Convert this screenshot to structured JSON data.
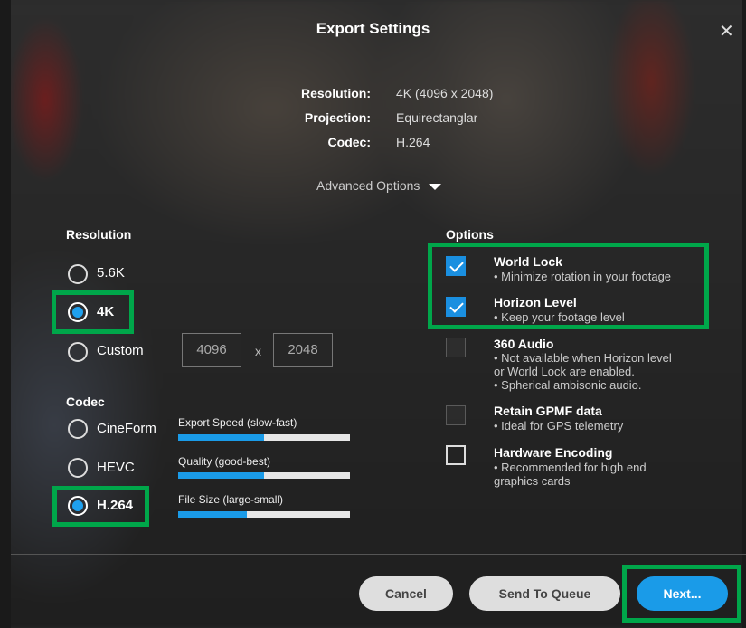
{
  "dialog": {
    "title": "Export Settings",
    "close_icon": "close-icon"
  },
  "summary": [
    {
      "label": "Resolution:",
      "value": "4K (4096 x 2048)"
    },
    {
      "label": "Projection:",
      "value": "Equirectanglar"
    },
    {
      "label": "Codec:",
      "value": "H.264"
    }
  ],
  "advanced_options": {
    "label": "Advanced Options",
    "icon": "caret-down-icon"
  },
  "resolution": {
    "heading": "Resolution",
    "options": [
      {
        "label": "5.6K",
        "checked": false
      },
      {
        "label": "4K",
        "checked": true
      },
      {
        "label": "Custom",
        "checked": false
      }
    ],
    "custom_width": "4096",
    "custom_height": "2048",
    "x_label": "x"
  },
  "codec": {
    "heading": "Codec",
    "options": [
      {
        "label": "CineForm",
        "checked": false
      },
      {
        "label": "HEVC",
        "checked": false
      },
      {
        "label": "H.264",
        "checked": true
      }
    ],
    "meters": [
      {
        "label": "Export Speed (slow-fast)",
        "value": 0.5
      },
      {
        "label": "Quality (good-best)",
        "value": 0.5
      },
      {
        "label": "File Size (large-small)",
        "value": 0.4
      }
    ]
  },
  "options": {
    "heading": "Options",
    "items": [
      {
        "title": "World Lock",
        "desc": [
          "• Minimize rotation in your footage"
        ],
        "state": "checked"
      },
      {
        "title": "Horizon Level",
        "desc": [
          "• Keep your footage level"
        ],
        "state": "checked"
      },
      {
        "title": "360 Audio",
        "desc": [
          "• Not available when Horizon level",
          "or World Lock are enabled.",
          "• Spherical ambisonic audio."
        ],
        "state": "disabled"
      },
      {
        "title": "Retain GPMF data",
        "desc": [
          "• Ideal for GPS telemetry"
        ],
        "state": "disabled"
      },
      {
        "title": "Hardware Encoding",
        "desc": [
          "• Recommended for high end",
          "graphics cards"
        ],
        "state": "unchecked"
      }
    ]
  },
  "footer": {
    "cancel": "Cancel",
    "send_to_queue": "Send To Queue",
    "next": "Next..."
  },
  "colors": {
    "accent": "#1a9be8",
    "highlight": "#00a64a"
  }
}
